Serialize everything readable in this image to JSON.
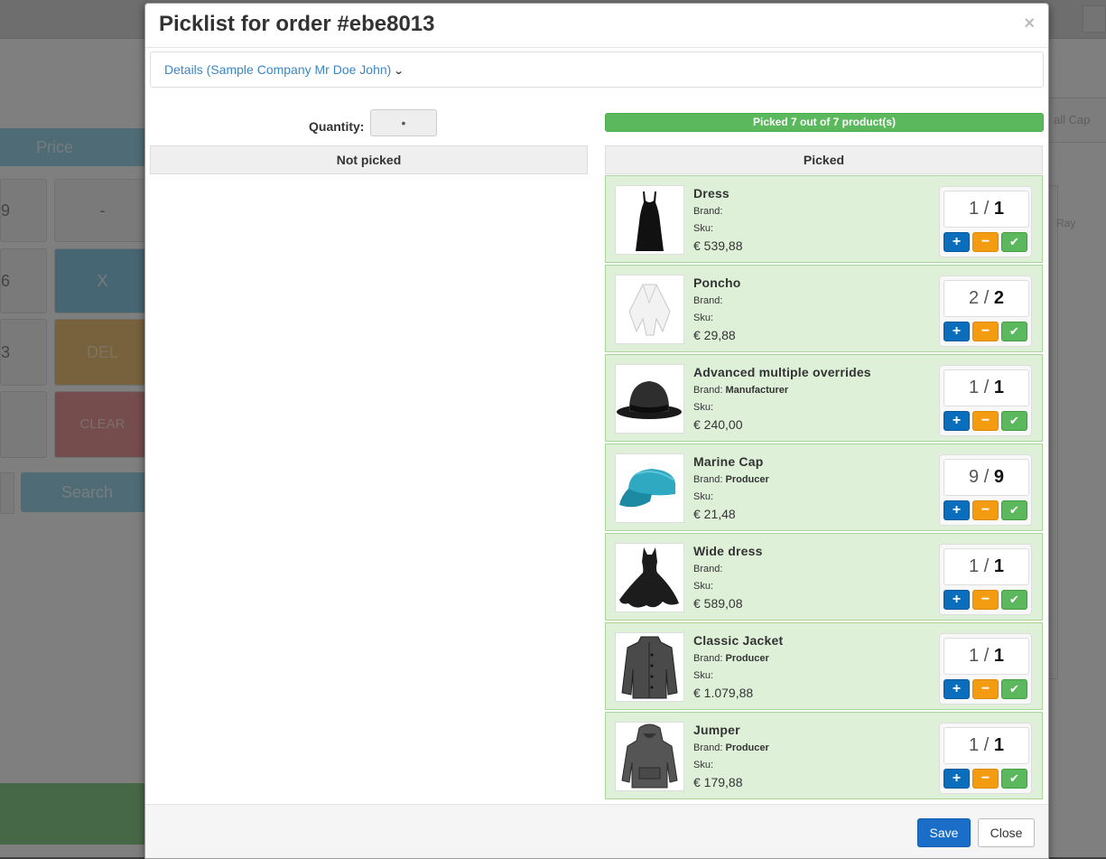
{
  "background": {
    "price_label": "Price",
    "key_minus": "-",
    "key_x": "X",
    "key_del": "DEL",
    "key_clear": "CLEAR",
    "search_label": "Search",
    "right_tab": "all Cap",
    "right_text": "Ray"
  },
  "modal": {
    "title": "Picklist for order #ebe8013",
    "close_glyph": "×",
    "details_link": "Details (Sample Company Mr Doe John)",
    "quantity_label": "Quantity:",
    "quantity_value": "•",
    "progress_text": "Picked 7 out of 7 product(s)",
    "progress_fraction": 1.0,
    "not_picked_header": "Not picked",
    "picked_header": "Picked",
    "brand_label": "Brand:",
    "sku_label": "Sku:",
    "save_label": "Save",
    "close_label": "Close"
  },
  "items": [
    {
      "name": "Dress",
      "brand": "",
      "sku": "",
      "price": "€ 539,88",
      "picked": "1",
      "total": "1",
      "image": "dress-image"
    },
    {
      "name": "Poncho",
      "brand": "",
      "sku": "",
      "price": "€ 29,88",
      "picked": "2",
      "total": "2",
      "image": "poncho-image"
    },
    {
      "name": "Advanced multiple overrides",
      "brand": "Manufacturer",
      "sku": "",
      "price": "€ 240,00",
      "picked": "1",
      "total": "1",
      "image": "bowler-hat-image"
    },
    {
      "name": "Marine Cap",
      "brand": "Producer",
      "sku": "",
      "price": "€ 21,48",
      "picked": "9",
      "total": "9",
      "image": "cap-image"
    },
    {
      "name": "Wide dress",
      "brand": "",
      "sku": "",
      "price": "€ 589,08",
      "picked": "1",
      "total": "1",
      "image": "wide-dress-image"
    },
    {
      "name": "Classic Jacket",
      "brand": "Producer",
      "sku": "",
      "price": "€ 1.079,88",
      "picked": "1",
      "total": "1",
      "image": "jacket-image"
    },
    {
      "name": "Jumper",
      "brand": "Producer",
      "sku": "",
      "price": "€ 179,88",
      "picked": "1",
      "total": "1",
      "image": "hoodie-image"
    }
  ],
  "counter_glyphs": {
    "plus": "+",
    "minus": "−",
    "check": "✔",
    "separator": "/"
  },
  "colors": {
    "picked_row": "#dff0d8",
    "progress": "#5cb85c",
    "plus_button": "#0a6ebd",
    "minus_button": "#f39c12",
    "check_button": "#5cb85c",
    "save_button": "#1a6ec8",
    "link": "#3a87c8"
  }
}
